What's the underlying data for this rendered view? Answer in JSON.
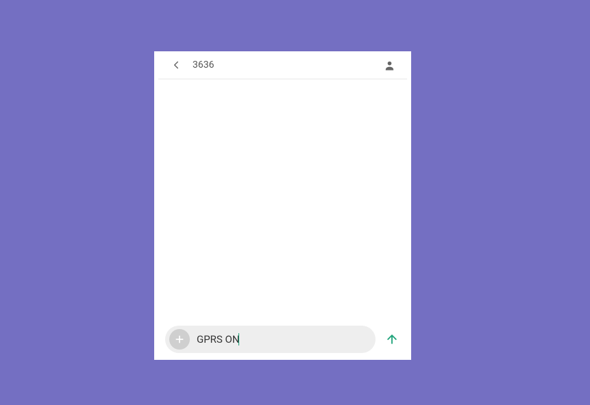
{
  "colors": {
    "background": "#746fc2",
    "accent": "#1fa37a",
    "pill": "#eeeeee",
    "attach": "#cfcfcf"
  },
  "header": {
    "contact": "3636"
  },
  "compose": {
    "value": "GPRS ON"
  }
}
